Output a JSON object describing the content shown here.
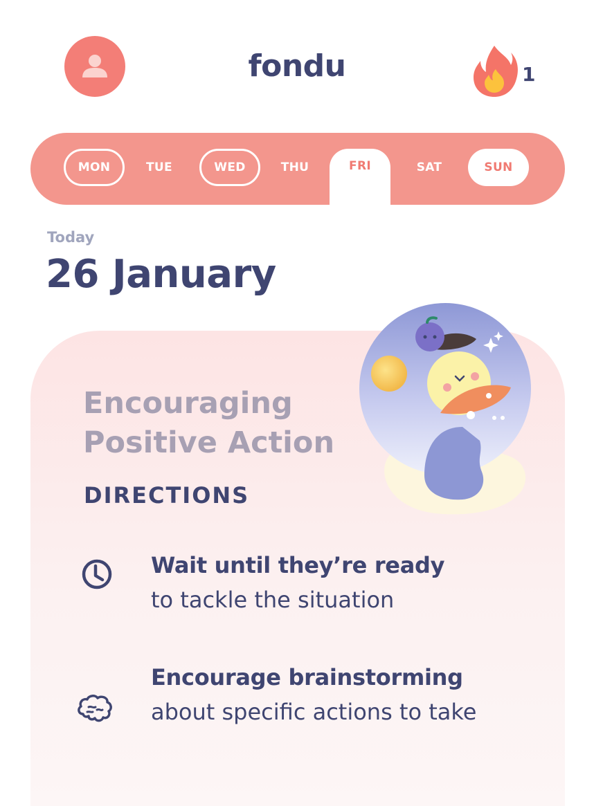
{
  "header": {
    "brand": "fondu",
    "avatar_icon": "user-icon",
    "streak_icon": "fire-icon",
    "streak_count": "1"
  },
  "days": [
    {
      "label": "MON",
      "state": "outlined"
    },
    {
      "label": "TUE",
      "state": "plain"
    },
    {
      "label": "WED",
      "state": "outlined"
    },
    {
      "label": "THU",
      "state": "plain"
    },
    {
      "label": "FRI",
      "state": "selected"
    },
    {
      "label": "SAT",
      "state": "plain"
    },
    {
      "label": "SUN",
      "state": "filled"
    }
  ],
  "today": {
    "label": "Today",
    "date": "26 January"
  },
  "card": {
    "title": "Encouraging Positive Action",
    "section_label": "DIRECTIONS",
    "directions": [
      {
        "icon": "clock-icon",
        "title": "Wait until they’re ready",
        "body": "to tackle the situation"
      },
      {
        "icon": "brain-icon",
        "title": "Encourage brainstorming",
        "body": "about specific actions to take"
      }
    ]
  },
  "colors": {
    "accent": "#f3968d",
    "accent_dark": "#f07a72",
    "text_primary": "#3f4571",
    "text_muted": "#a0a5bd",
    "card_bg": "#fde4e4"
  }
}
